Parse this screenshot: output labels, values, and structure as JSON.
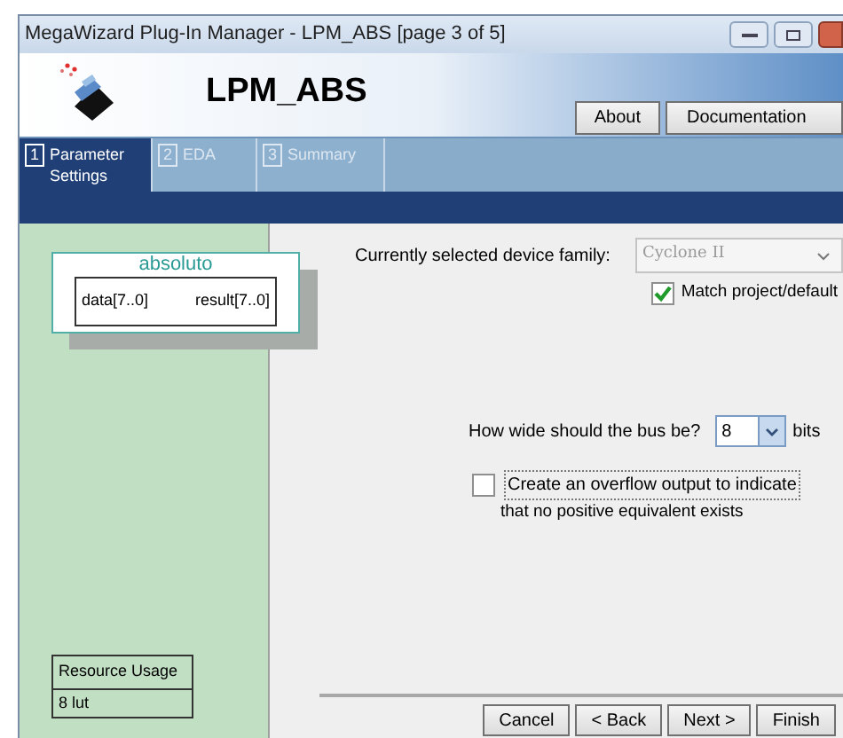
{
  "window": {
    "title": "MegaWizard Plug-In Manager - LPM_ABS [page 3 of 5]"
  },
  "header": {
    "title": "LPM_ABS",
    "buttons": [
      "About",
      "Documentation"
    ]
  },
  "tabs": [
    {
      "number": "1",
      "label": "Parameter Settings",
      "selected": true
    },
    {
      "number": "2",
      "label": "EDA",
      "selected": false
    },
    {
      "number": "3",
      "label": "Summary",
      "selected": false
    }
  ],
  "symbol": {
    "name": "absoluto",
    "input": "data[7..0]",
    "output": "result[7..0]"
  },
  "resource_usage": {
    "title": "Resource Usage",
    "value": "8 lut"
  },
  "device_family": {
    "label": "Currently selected device family:",
    "value": "Cyclone II",
    "disabled": true
  },
  "match_project": {
    "label": "Match project/default",
    "checked": true
  },
  "bus_width": {
    "label": "How wide should the bus be?",
    "value": "8",
    "unit": "bits"
  },
  "overflow": {
    "label": "Create an overflow output to indicate",
    "note": "that no positive equivalent exists",
    "checked": false
  },
  "buttons": [
    "Cancel",
    "< Back",
    "Next >",
    "Finish"
  ]
}
